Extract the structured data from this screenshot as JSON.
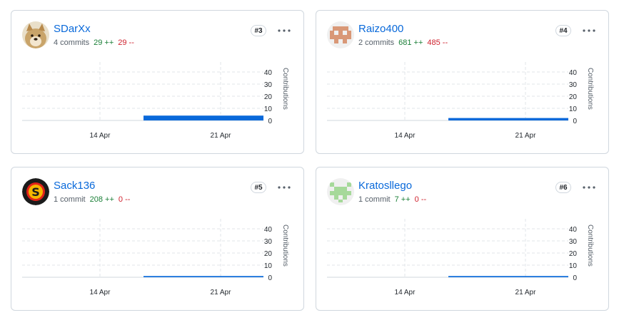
{
  "y_axis_label": "Contributions",
  "y_ticks": [
    "40",
    "30",
    "20",
    "10",
    "0"
  ],
  "x_ticks": [
    "14 Apr",
    "21 Apr"
  ],
  "colors": {
    "bar": "#0969da",
    "link": "#0969da",
    "add": "#1a7f37",
    "del": "#cf222e"
  },
  "contributors": [
    {
      "name": "SDarXx",
      "commits": "4 commits",
      "additions": "29 ++",
      "deletions": "29 --",
      "rank": "#3",
      "avatar": "doge-avatar",
      "chart_level": 4
    },
    {
      "name": "Raizo400",
      "commits": "2 commits",
      "additions": "681 ++",
      "deletions": "485 --",
      "rank": "#4",
      "avatar": "pixel-invader-avatar",
      "chart_level": 2
    },
    {
      "name": "Sack136",
      "commits": "1 commit",
      "additions": "208 ++",
      "deletions": "0 --",
      "rank": "#5",
      "avatar": "s-logo-avatar",
      "chart_level": 1
    },
    {
      "name": "Kratosllego",
      "commits": "1 commit",
      "additions": "7 ++",
      "deletions": "0 --",
      "rank": "#6",
      "avatar": "pixel-identicon-avatar",
      "chart_level": 1
    }
  ],
  "chart_data": [
    {
      "type": "area",
      "title": "SDarXx",
      "x": [
        "14 Apr",
        "21 Apr"
      ],
      "series": [
        {
          "values": [
            0,
            4
          ]
        }
      ],
      "ylabel": "Contributions",
      "ylim": [
        0,
        40
      ]
    },
    {
      "type": "area",
      "title": "Raizo400",
      "x": [
        "14 Apr",
        "21 Apr"
      ],
      "series": [
        {
          "values": [
            0,
            2
          ]
        }
      ],
      "ylabel": "Contributions",
      "ylim": [
        0,
        40
      ]
    },
    {
      "type": "area",
      "title": "Sack136",
      "x": [
        "14 Apr",
        "21 Apr"
      ],
      "series": [
        {
          "values": [
            0,
            1
          ]
        }
      ],
      "ylabel": "Contributions",
      "ylim": [
        0,
        40
      ]
    },
    {
      "type": "area",
      "title": "Kratosllego",
      "x": [
        "14 Apr",
        "21 Apr"
      ],
      "series": [
        {
          "values": [
            0,
            1
          ]
        }
      ],
      "ylabel": "Contributions",
      "ylim": [
        0,
        40
      ]
    }
  ]
}
